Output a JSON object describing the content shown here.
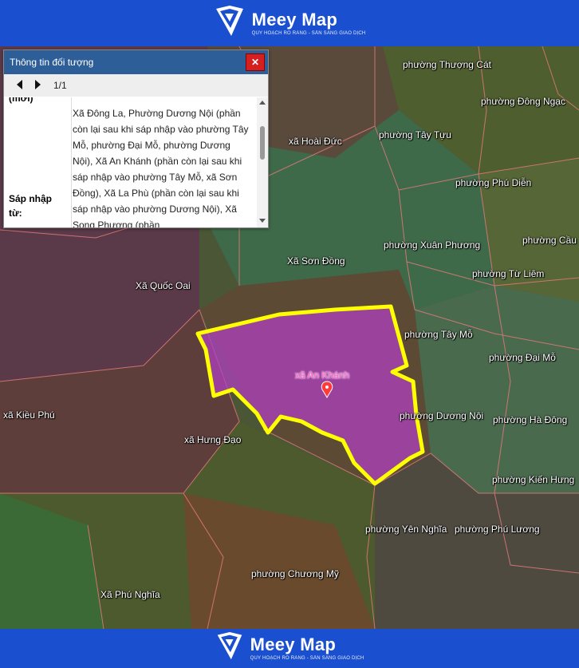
{
  "brand": {
    "name": "Meey Map",
    "tagline": "QUY HOẠCH RÕ RÀNG - SẴN SÀNG GIAO DỊCH"
  },
  "footer": {
    "name": "Meey Map",
    "tagline": "QUY HOẠCH RÕ RÀNG - SẴN SÀNG GIAO DỊCH"
  },
  "panel": {
    "title": "Thông tin đối tượng",
    "pager": "1/1",
    "partial_label": "(mới)",
    "merge_label": "Sáp nhập từ:",
    "merge_value": "Xã Đông La, Phường Dương Nội (phần còn lại sau khi sáp nhập vào phường Tây Mỗ, phường Đại Mỗ, phường Dương Nội), Xã An Khánh (phần còn lại sau khi sáp nhập vào phường Tây Mỗ, xã Sơn Đồng), Xã La Phù (phần còn lại sau khi sáp nhập vào phường Dương Nội), Xã Song Phương (phần"
  },
  "map": {
    "selected": "xã An Khánh",
    "labels": [
      "phường Thượng Cát",
      "phường Đông Ngạc",
      "xã Hoài Đức",
      "phường Tây Tựu",
      "phường Phú Diễn",
      "phường Xuân Phương",
      "phường Cầu",
      "phường Từ Liêm",
      "Xã Sơn Đồng",
      "Xã Quốc Oai",
      "phường Tây Mỗ",
      "phường Đại Mỗ",
      "phường Dương Nội",
      "phường Hà Đông",
      "xã Kiều Phú",
      "xã Hưng Đạo",
      "phường Kiến Hưng",
      "phường Yên Nghĩa",
      "phường Phú Lương",
      "phường Chương Mỹ",
      "Xã Phú Nghĩa"
    ]
  },
  "colors": {
    "brand": "#1a4fd0",
    "highlight_border": "#ffff00",
    "highlight_fill": "#b040c0",
    "panel_header": "#2d5e98",
    "close": "#d62020"
  }
}
